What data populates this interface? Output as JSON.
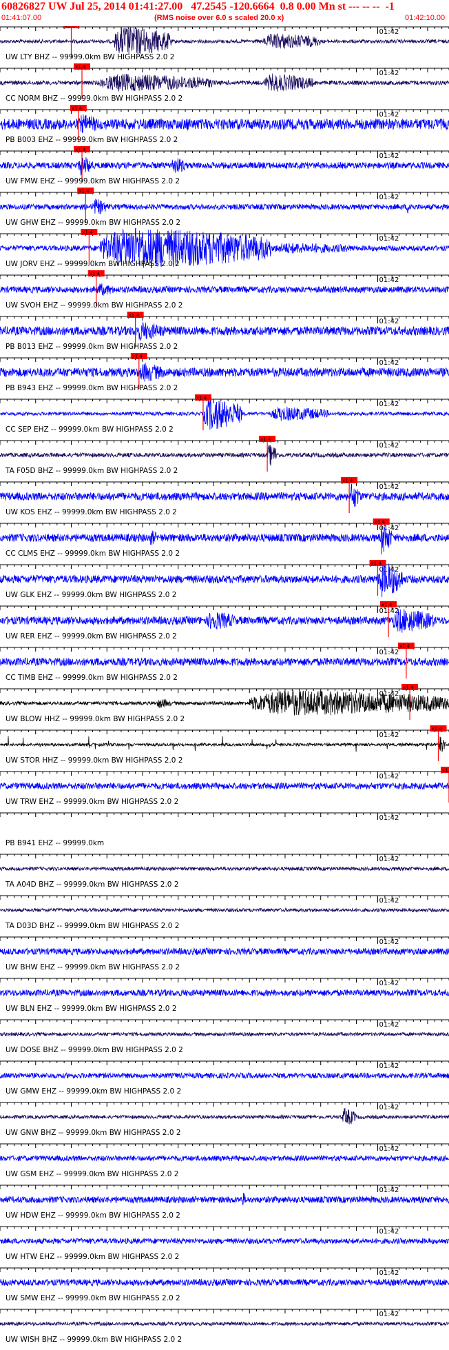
{
  "header": {
    "title": "60826827 UW Jul 25, 2014 01:41:27.00   47.2545 -120.6664  0.8 0.00 Mn st --- -- --  -1",
    "start_time": "01:41:07.00",
    "subtitle": "(RMS noise over 6.0 s scaled 20.0 x)",
    "end_time": "01:42:10.00"
  },
  "colors": {
    "text_red": "#ff0000",
    "trace_blue": "#0000ff",
    "trace_navy": "#1a0a5c",
    "trace_black": "#000000",
    "pick_red": "#ff0000"
  },
  "chart_data": {
    "type": "seismogram",
    "time_start": "01:41:07.00",
    "time_end": "01:42:10.00",
    "minute_mark_label": "01:42",
    "minute_mark_seconds": 53,
    "duration_seconds": 63,
    "pick_label": "x1.4",
    "traces": [
      {
        "label": "UW LTY BHZ -- 99999.0km BW  HIGHPASS  2.0  2",
        "color": "#1a0a5c",
        "noise": 0.1,
        "pick": 10.0,
        "bursts": [
          [
            16,
            24,
            0.95
          ],
          [
            37,
            45,
            0.5
          ]
        ]
      },
      {
        "label": "CC NORM BHZ -- 99999.0km BW  HIGHPASS  2.0  2",
        "color": "#1a0a5c",
        "noise": 0.12,
        "pick": 11.5,
        "bursts": [
          [
            14,
            30,
            0.55
          ],
          [
            37,
            44,
            0.55
          ]
        ]
      },
      {
        "label": "PB B003 EHZ -- 99999.0km BW  HIGHPASS  2.0  2",
        "color": "#0000ff",
        "noise": 0.3,
        "pick": 11.0,
        "bursts": [
          [
            11,
            14,
            0.6
          ],
          [
            26,
            27,
            0.45
          ]
        ]
      },
      {
        "label": "UW FMW EHZ -- 99999.0km BW  HIGHPASS  2.0  2",
        "color": "#0000ff",
        "noise": 0.18,
        "pick": 11.5,
        "bursts": [
          [
            11,
            13,
            0.6
          ],
          [
            24,
            26,
            0.55
          ]
        ]
      },
      {
        "label": "UW GHW EHZ -- 99999.0km BW  HIGHPASS  2.0  2",
        "color": "#0000ff",
        "noise": 0.15,
        "pick": 12.0,
        "bursts": [
          [
            13,
            15,
            0.5
          ],
          [
            57,
            58,
            0.4
          ]
        ]
      },
      {
        "label": "UW JORV EHZ -- 99999.0km BW  HIGHPASS  2.0  2",
        "color": "#0000ff",
        "noise": 0.15,
        "pick": 12.5,
        "bursts": [
          [
            14,
            38,
            1.3
          ],
          [
            38,
            50,
            0.35
          ]
        ]
      },
      {
        "label": "UW SVOH EHZ -- 99999.0km BW  HIGHPASS  2.0  2",
        "color": "#0000ff",
        "noise": 0.18,
        "pick": 13.5,
        "bursts": [
          [
            13.5,
            16,
            0.4
          ]
        ]
      },
      {
        "label": "PB B013 EHZ -- 99999.0km BW  HIGHPASS  2.0  2",
        "color": "#0000ff",
        "noise": 0.25,
        "pick": 19.0,
        "bursts": [
          [
            19,
            23,
            0.6
          ]
        ]
      },
      {
        "label": "PB B943 EHZ -- 99999.0km BW  HIGHPASS  2.0  2",
        "color": "#0000ff",
        "noise": 0.25,
        "pick": 19.5,
        "bursts": [
          [
            19.5,
            23,
            0.6
          ]
        ]
      },
      {
        "label": "CC SEP EHZ -- 99999.0km BW  HIGHPASS  2.0  2",
        "color": "#0000ff",
        "noise": 0.1,
        "pick": 28.5,
        "bursts": [
          [
            28.5,
            34,
            1.0
          ],
          [
            38,
            46,
            0.45
          ]
        ]
      },
      {
        "label": "TA F05D BHZ -- 99999.0km BW  HIGHPASS  2.0  2",
        "color": "#1a0a5c",
        "noise": 0.12,
        "pick": 37.5,
        "bursts": [
          [
            37.5,
            39,
            0.7
          ]
        ]
      },
      {
        "label": "UW KOS EHZ -- 99999.0km BW  HIGHPASS  2.0  2",
        "color": "#0000ff",
        "noise": 0.22,
        "pick": 49.0,
        "bursts": [
          [
            49,
            50.5,
            0.8
          ]
        ]
      },
      {
        "label": "CC CLMS EHZ -- 99999.0km BW  HIGHPASS  2.0  2",
        "color": "#0000ff",
        "noise": 0.22,
        "pick": 53.5,
        "bursts": [
          [
            53.5,
            55,
            0.9
          ],
          [
            21,
            22,
            0.5
          ]
        ]
      },
      {
        "label": "UW GLK EHZ -- 99999.0km BW  HIGHPASS  2.0  2",
        "color": "#0000ff",
        "noise": 0.22,
        "pick": 53.0,
        "bursts": [
          [
            53,
            56.5,
            1.1
          ]
        ]
      },
      {
        "label": "UW RER EHZ -- 99999.0km BW  HIGHPASS  2.0  2",
        "color": "#0000ff",
        "noise": 0.22,
        "pick": 54.5,
        "bursts": [
          [
            29,
            33,
            0.6
          ],
          [
            55,
            61,
            0.75
          ]
        ]
      },
      {
        "label": "CC TIMB EHZ -- 99999.0km BW  HIGHPASS  2.0  2",
        "color": "#0000ff",
        "noise": 0.22,
        "pick": 57.0,
        "bursts": [
          [
            57,
            63,
            0.25
          ]
        ]
      },
      {
        "label": "UW BLOW HHZ -- 99999.0km BW  HIGHPASS  2.0  2",
        "color": "#000000",
        "noise": 0.1,
        "pick": 57.5,
        "bursts": [
          [
            35,
            63,
            0.8
          ],
          [
            22,
            24,
            0.3
          ]
        ]
      },
      {
        "label": "UW STOR HHZ -- 99999.0km BW  HIGHPASS  2.0  2",
        "color": "#000000",
        "noise": 0.08,
        "pick": 61.5,
        "bursts": [
          [
            61.5,
            62.5,
            0.6
          ]
        ],
        "spikes": true
      },
      {
        "label": "UW TRW EHZ -- 99999.0km BW  HIGHPASS  2.0  2",
        "color": "#0000ff",
        "noise": 0.18,
        "pick": 63.0,
        "bursts": []
      },
      {
        "label": "PB B941 EHZ -- 99999.0km",
        "color": "#0000ff",
        "noise": 0.0,
        "pick": null,
        "bursts": []
      },
      {
        "label": "TA A04D BHZ -- 99999.0km BW  HIGHPASS  2.0  2",
        "color": "#1a0a5c",
        "noise": 0.1,
        "pick": null,
        "bursts": []
      },
      {
        "label": "TA D03D BHZ -- 99999.0km BW  HIGHPASS  2.0  2",
        "color": "#1a0a5c",
        "noise": 0.1,
        "pick": null,
        "bursts": []
      },
      {
        "label": "UW BHW EHZ -- 99999.0km BW  HIGHPASS  2.0  2",
        "color": "#0000ff",
        "noise": 0.18,
        "pick": null,
        "bursts": []
      },
      {
        "label": "UW BLN EHZ -- 99999.0km BW  HIGHPASS  2.0  2",
        "color": "#0000ff",
        "noise": 0.18,
        "pick": null,
        "bursts": []
      },
      {
        "label": "UW DOSE BHZ -- 99999.0km BW  HIGHPASS  2.0  2",
        "color": "#1a0a5c",
        "noise": 0.1,
        "pick": null,
        "bursts": []
      },
      {
        "label": "UW GMW EHZ -- 99999.0km BW  HIGHPASS  2.0  2",
        "color": "#0000ff",
        "noise": 0.15,
        "pick": null,
        "bursts": []
      },
      {
        "label": "UW GNW BHZ -- 99999.0km BW  HIGHPASS  2.0  2",
        "color": "#1a0a5c",
        "noise": 0.1,
        "pick": null,
        "bursts": [
          [
            48,
            50,
            0.55
          ]
        ]
      },
      {
        "label": "UW GSM EHZ -- 99999.0km BW  HIGHPASS  2.0  2",
        "color": "#0000ff",
        "noise": 0.15,
        "pick": null,
        "bursts": []
      },
      {
        "label": "UW HDW EHZ -- 99999.0km BW  HIGHPASS  2.0  2",
        "color": "#0000ff",
        "noise": 0.18,
        "pick": null,
        "bursts": [
          [
            34,
            34.4,
            0.5
          ]
        ]
      },
      {
        "label": "UW HTW EHZ -- 99999.0km BW  HIGHPASS  2.0  2",
        "color": "#0000ff",
        "noise": 0.15,
        "pick": null,
        "bursts": []
      },
      {
        "label": "UW SMW EHZ -- 99999.0km BW  HIGHPASS  2.0  2",
        "color": "#0000ff",
        "noise": 0.18,
        "pick": null,
        "bursts": []
      },
      {
        "label": "UW WISH BHZ -- 99999.0km BW  HIGHPASS  2.0  2",
        "color": "#1a0a5c",
        "noise": 0.1,
        "pick": null,
        "bursts": []
      }
    ]
  }
}
